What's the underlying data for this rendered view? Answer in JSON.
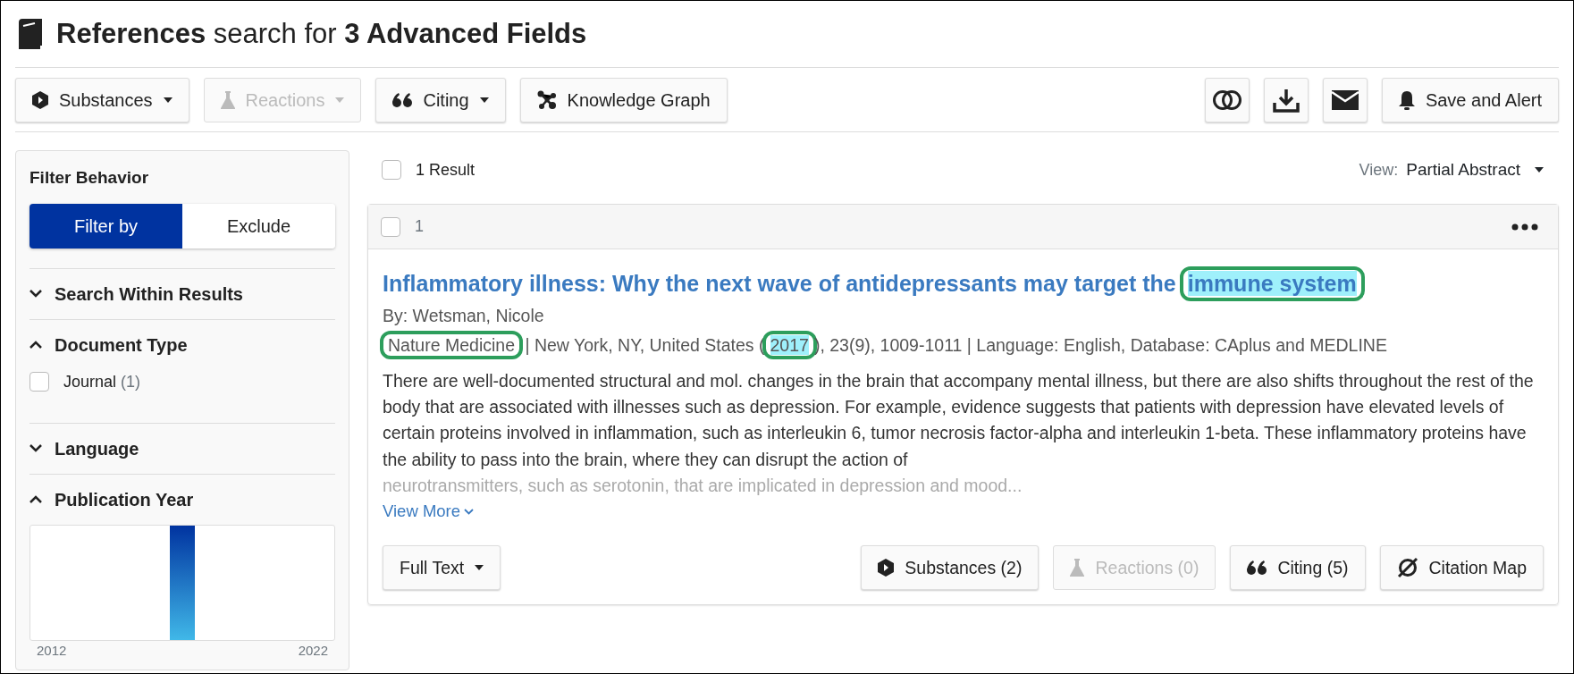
{
  "header": {
    "title": "**References** search for **3 Advanced Fields**"
  },
  "toolbar": {
    "left": [
      {
        "label": "Substances",
        "kind": "substances",
        "dropdown": true,
        "disabled": false
      },
      {
        "label": "Reactions",
        "kind": "reactions",
        "dropdown": true,
        "disabled": true
      },
      {
        "label": "Citing",
        "kind": "citing",
        "dropdown": true,
        "disabled": false
      },
      {
        "label": "Knowledge Graph",
        "kind": "graph",
        "dropdown": false,
        "disabled": false
      }
    ],
    "right": [
      {
        "kind": "combine"
      },
      {
        "kind": "download"
      },
      {
        "kind": "email"
      },
      {
        "kind": "alert",
        "label": "Save and Alert"
      }
    ]
  },
  "sidebar": {
    "title": "Filter Behavior",
    "modes": [
      {
        "label": "Filter by",
        "selected": true
      },
      {
        "label": "Exclude",
        "selected": false
      }
    ],
    "sections": [
      {
        "title": "Search Within Results",
        "expanded": false
      },
      {
        "title": "Document Type",
        "expanded": true,
        "options": [
          {
            "label": "Journal",
            "count": "(1)",
            "checked": false
          }
        ]
      },
      {
        "title": "Language",
        "expanded": false
      },
      {
        "title": "Publication Year",
        "expanded": true,
        "year_start": "2012",
        "year_end": "2022"
      }
    ]
  },
  "results": {
    "select_all_checked": false,
    "count": "1 Result",
    "view_label": "View:",
    "view_value": "Partial Abstract",
    "items": [
      {
        "number": "1",
        "checked": false,
        "title_parts": [
          {
            "text": "Inflammatory illness: Why the next wave of antidepressants may target the ",
            "highlight": false,
            "circled": false
          },
          {
            "text": "immune system",
            "highlight": true,
            "circled": true
          }
        ],
        "byline": "By: Wetsman, Nicole",
        "source_parts": [
          {
            "text": "Nature Medicine",
            "highlight": false,
            "circled": true
          },
          {
            "text": " | New York, NY, United States (",
            "highlight": false,
            "circled": false
          },
          {
            "text": "2017",
            "highlight": true,
            "circled": true
          },
          {
            "text": "), 23(9), 1009-1011 | Language: English, Database: CAplus and MEDLINE",
            "highlight": false,
            "circled": false
          }
        ],
        "abstract": "There are well-documented structural and mol. changes in the brain that accompany mental illness, but there are also shifts throughout the rest of the body that are associated with illnesses such as depression. For example, evidence suggests that patients with depression have elevated levels of certain proteins involved in inflammation, such as interleukin 6, tumor necrosis factor-alpha and interleukin 1-beta. These inflammatory proteins have the ability to pass into the brain, where they can disrupt the action of",
        "abstract_faded": "neurotransmitters, such as serotonin, that are implicated in depression and mood...",
        "more_link": "View More",
        "actions": [
          {
            "label": "Full Text",
            "kind": "fulltext",
            "dropdown": true,
            "disabled": false
          },
          {
            "label": "Substances (2)",
            "kind": "substances",
            "dropdown": false,
            "disabled": false
          },
          {
            "label": "Reactions (0)",
            "kind": "reactions",
            "dropdown": false,
            "disabled": true
          },
          {
            "label": "Citing (5)",
            "kind": "citing",
            "dropdown": false,
            "disabled": false
          },
          {
            "label": "Citation Map",
            "kind": "map",
            "dropdown": false,
            "disabled": false
          }
        ]
      }
    ]
  }
}
